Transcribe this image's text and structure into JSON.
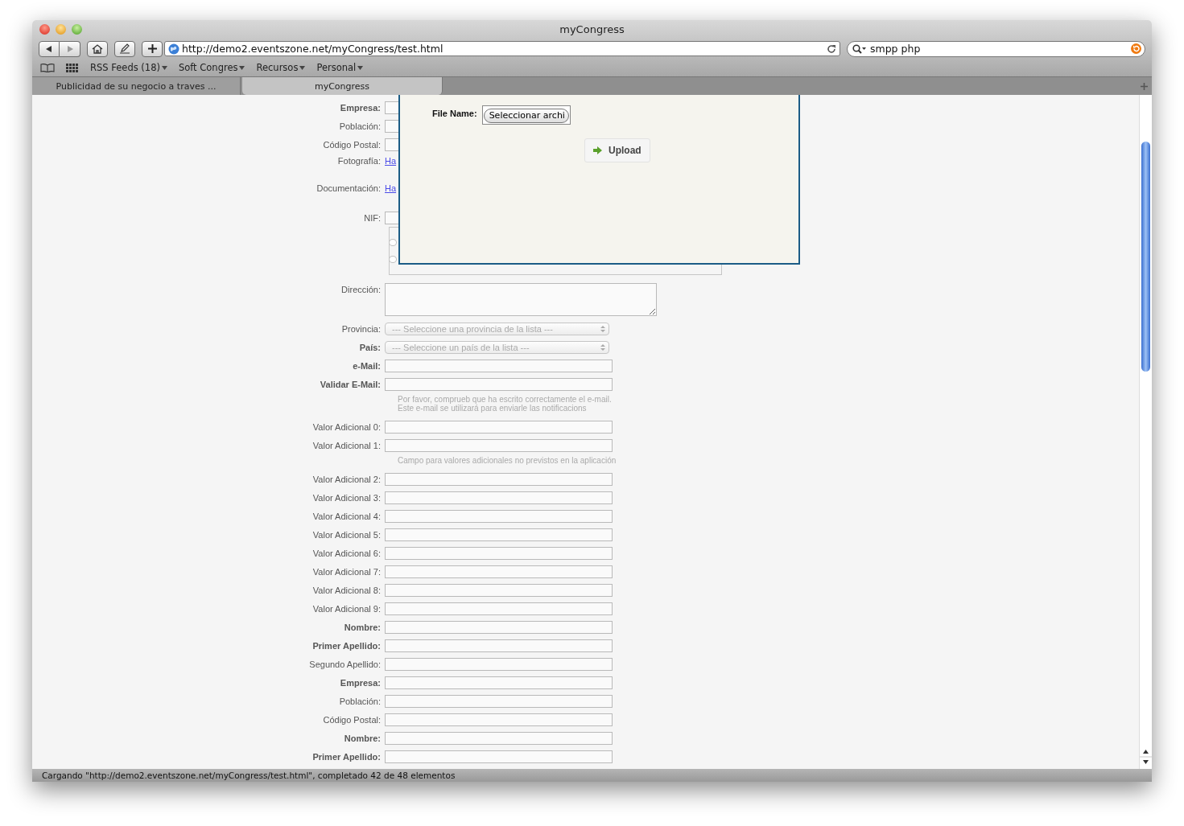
{
  "window": {
    "title": "myCongress"
  },
  "toolbar": {
    "url": "http://demo2.eventszone.net/myCongress/test.html",
    "search": "smpp php"
  },
  "bookmarks": [
    {
      "label": "RSS Feeds (18)",
      "menu": true
    },
    {
      "label": "Soft Congres",
      "menu": true
    },
    {
      "label": "Recursos",
      "menu": true
    },
    {
      "label": "Personal",
      "menu": true
    }
  ],
  "tabs": [
    {
      "label": "Publicidad de su negocio a traves ...",
      "selected": false
    },
    {
      "label": "myCongress",
      "selected": true
    }
  ],
  "form": {
    "rows": [
      {
        "kind": "text",
        "label": "Empresa:",
        "bold": true
      },
      {
        "kind": "text",
        "label": "Población:",
        "bold": false
      },
      {
        "kind": "text",
        "label": "Código Postal:",
        "bold": false
      },
      {
        "kind": "link",
        "label": "Fotografía:",
        "bold": false,
        "link": "Ha"
      },
      {
        "kind": "link",
        "label": "Documentación:",
        "bold": false,
        "link": "Ha"
      },
      {
        "kind": "text",
        "label": "NIF:",
        "bold": false
      },
      {
        "kind": "radio-group",
        "options": [
          {
            "selected": false
          },
          {
            "selected": false
          }
        ]
      },
      {
        "kind": "textarea",
        "label": "Dirección:",
        "bold": false
      },
      {
        "kind": "select",
        "label": "Provincia:",
        "bold": false,
        "value": "--- Seleccione una provincia de la lista ---",
        "disabled": true
      },
      {
        "kind": "select",
        "label": "País:",
        "bold": true,
        "value": "--- Seleccione un país de la lista ---",
        "disabled": true
      },
      {
        "kind": "text",
        "label": "e-Mail:",
        "bold": true
      },
      {
        "kind": "text",
        "label": "Validar E-Mail:",
        "bold": true
      },
      {
        "kind": "hint",
        "lines": [
          "Por favor, comprueb que ha escrito correctamente el e-mail.",
          "Este e-mail se utilizará para enviarle las notificacions"
        ]
      },
      {
        "kind": "text",
        "label": "Valor Adicional 0:",
        "bold": false
      },
      {
        "kind": "text",
        "label": "Valor Adicional 1:",
        "bold": false
      },
      {
        "kind": "hint",
        "lines": [
          "Campo para valores adicionales no previstos en la aplicación"
        ]
      },
      {
        "kind": "text",
        "label": "Valor Adicional 2:",
        "bold": false
      },
      {
        "kind": "text",
        "label": "Valor Adicional 3:",
        "bold": false
      },
      {
        "kind": "text",
        "label": "Valor Adicional 4:",
        "bold": false
      },
      {
        "kind": "text",
        "label": "Valor Adicional 5:",
        "bold": false
      },
      {
        "kind": "text",
        "label": "Valor Adicional 6:",
        "bold": false
      },
      {
        "kind": "text",
        "label": "Valor Adicional 7:",
        "bold": false
      },
      {
        "kind": "text",
        "label": "Valor Adicional 8:",
        "bold": false
      },
      {
        "kind": "text",
        "label": "Valor Adicional 9:",
        "bold": false
      },
      {
        "kind": "text",
        "label": "Nombre:",
        "bold": true
      },
      {
        "kind": "text",
        "label": "Primer Apellido:",
        "bold": true
      },
      {
        "kind": "text",
        "label": "Segundo Apellido:",
        "bold": false
      },
      {
        "kind": "text",
        "label": "Empresa:",
        "bold": true
      },
      {
        "kind": "text",
        "label": "Población:",
        "bold": false
      },
      {
        "kind": "text",
        "label": "Código Postal:",
        "bold": false
      },
      {
        "kind": "text",
        "label": "Nombre:",
        "bold": true
      },
      {
        "kind": "text",
        "label": "Primer Apellido:",
        "bold": true
      }
    ]
  },
  "upload_dialog": {
    "file_label": "File Name:",
    "file_button": "Seleccionar archi",
    "upload_button": "Upload"
  },
  "status_bar": "Cargando \"http://demo2.eventszone.net/myCongress/test.html\", completado 42 de 48 elementos"
}
